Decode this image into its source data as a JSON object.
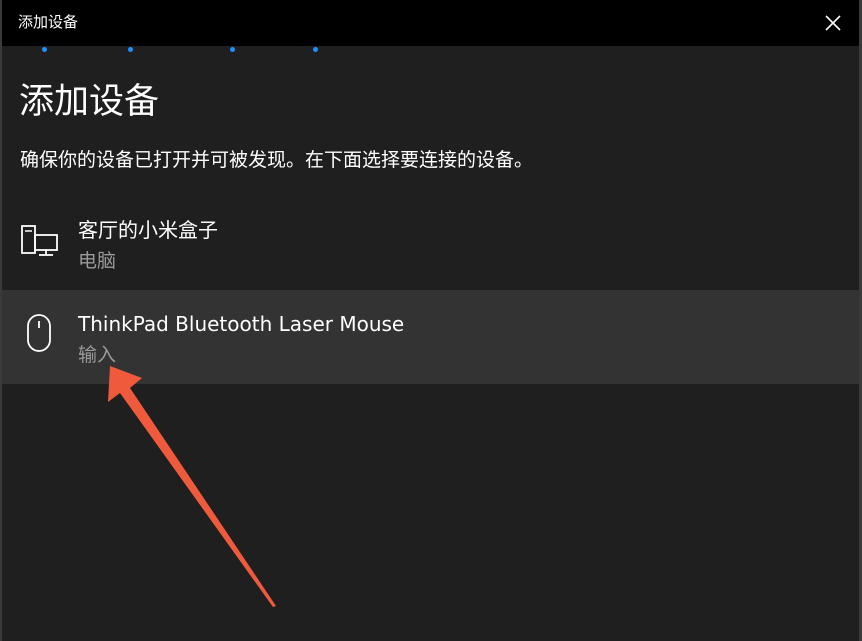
{
  "window": {
    "title": "添加设备"
  },
  "main": {
    "heading": "添加设备",
    "subtitle": "确保你的设备已打开并可被发现。在下面选择要连接的设备。"
  },
  "devices": [
    {
      "name": "客厅的小米盒子",
      "type": "电脑",
      "icon": "computer-icon"
    },
    {
      "name": "ThinkPad Bluetooth Laser Mouse",
      "type": "输入",
      "icon": "mouse-icon"
    }
  ],
  "colors": {
    "accent": "#1e90ff",
    "annotation_arrow": "#f05a3c",
    "selected_row": "#333333"
  }
}
